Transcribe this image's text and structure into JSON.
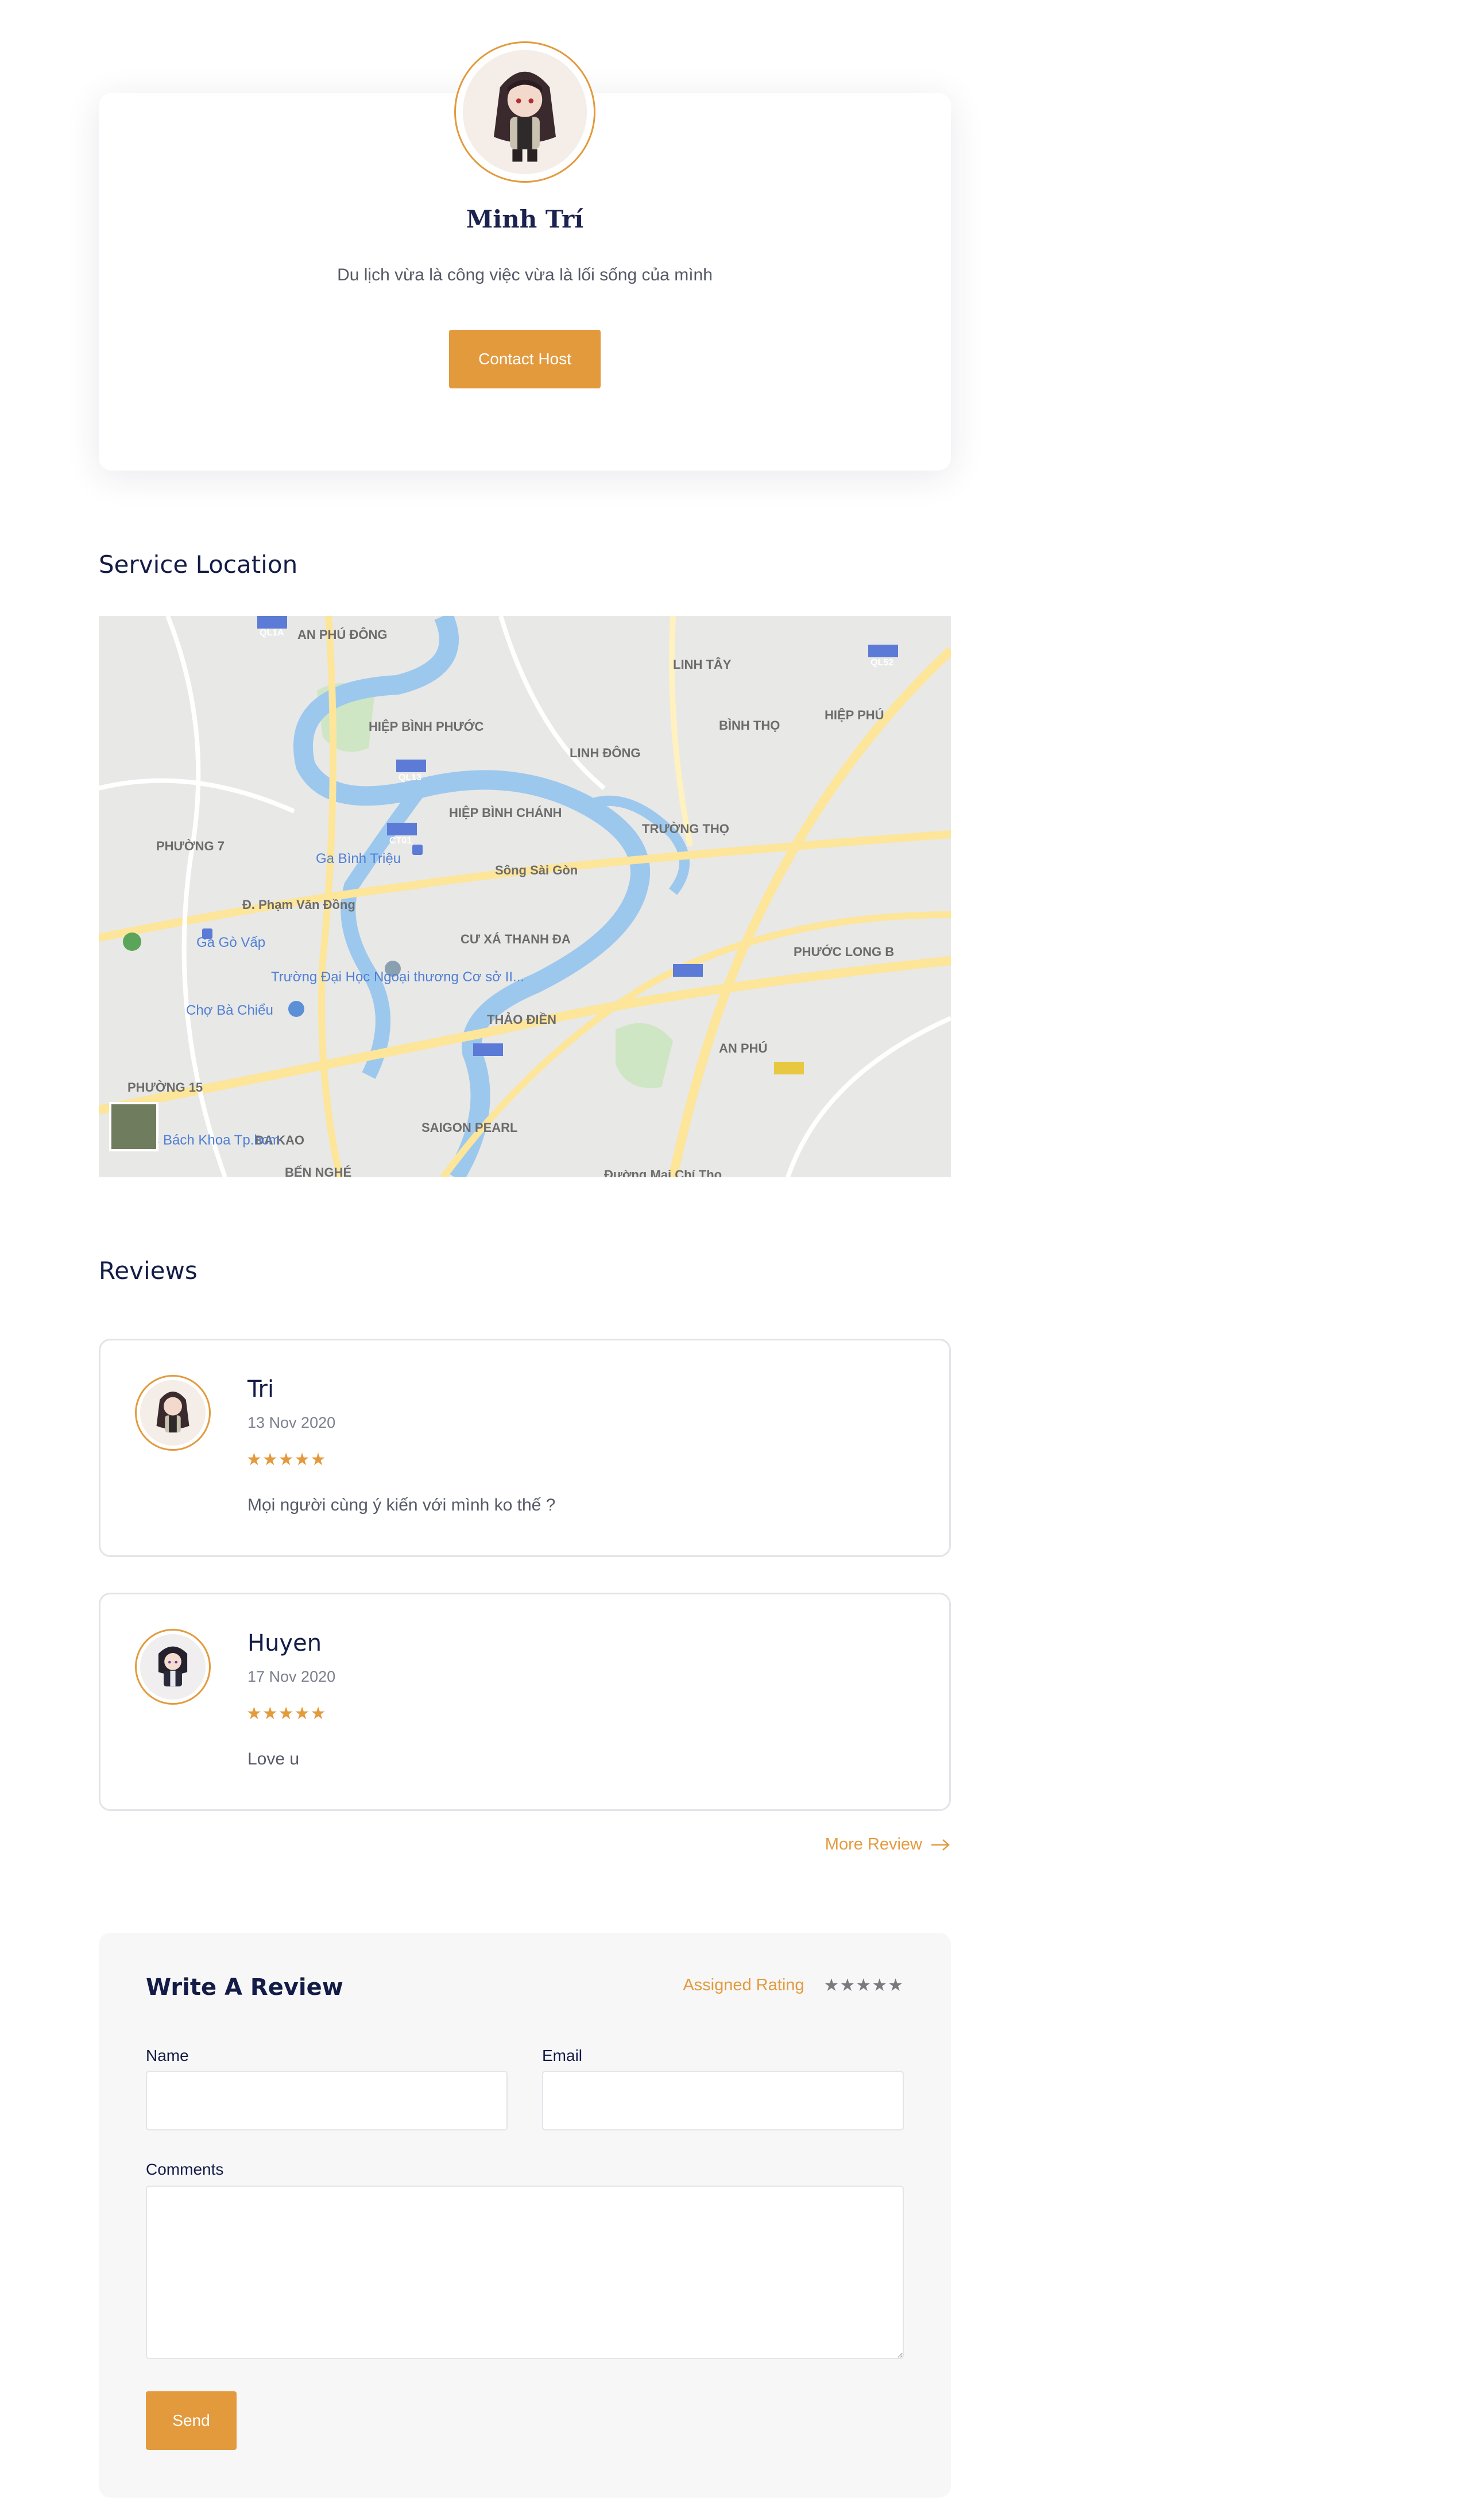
{
  "host": {
    "name": "Minh Trí",
    "bio": "Du lịch vừa là công việc vừa là lối sống của mình",
    "contact_label": "Contact Host"
  },
  "location": {
    "title": "Service Location",
    "map_labels": [
      "AN PHÚ ĐÔNG",
      "LINH TÂY",
      "HIỆP BÌNH PHƯỚC",
      "BÌNH THỌ",
      "HIỆP PHÚ",
      "LINH ĐÔNG",
      "HIỆP BÌNH CHÁNH",
      "TRƯỜNG THỌ",
      "PHƯỜNG 7",
      "Ga Bình Triệu",
      "Đ. Phạm Văn Đồng",
      "Ga Gò Vấp",
      "CƯ XÁ THANH ĐA",
      "PHƯỚC LONG B",
      "Trường Đại Học Ngoại thương Cơ sở II...",
      "Chợ Bà Chiểu",
      "THẢO ĐIỀN",
      "AN PHÚ",
      "PHƯỜNG 15",
      "ĐA KAO",
      "SAIGON PEARL",
      "Đại Học Bách Khoa Tp.hcm",
      "BẾN NGHÉ",
      "Đường Mai Chí Thọ",
      "Sông Sài Gòn",
      "QL1A",
      "QL52",
      "QL13",
      "CT01"
    ]
  },
  "reviews": {
    "title": "Reviews",
    "items": [
      {
        "name": "Tri",
        "date": "13 Nov 2020",
        "stars": "★★★★★",
        "text": "Mọi người cùng ý kiến với mình ko thế ?"
      },
      {
        "name": "Huyen",
        "date": "17 Nov 2020",
        "stars": "★★★★★",
        "text": "Love u"
      }
    ],
    "more_label": "More Review"
  },
  "write_review": {
    "title": "Write A Review",
    "assigned_label": "Assigned Rating",
    "assigned_stars": "★★★★★",
    "name_label": "Name",
    "email_label": "Email",
    "comments_label": "Comments",
    "name_value": "",
    "email_value": "",
    "comments_value": "",
    "send_label": "Send"
  },
  "colors": {
    "accent": "#e39a3d",
    "heading": "#131c47",
    "river": "#9dc8ee",
    "road": "#fde59a"
  },
  "icons": {
    "more_review": "arrow-right-icon",
    "map_pin": "map-pin-icon"
  }
}
